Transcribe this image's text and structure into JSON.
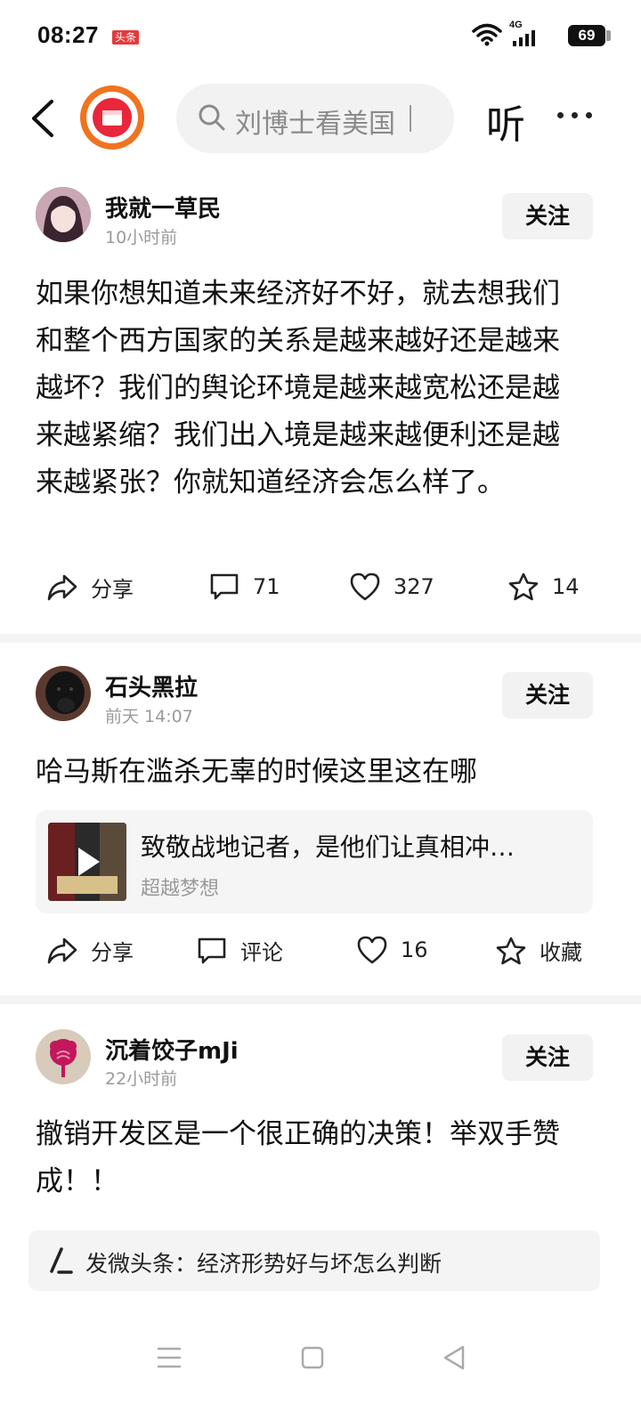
{
  "status_bar": {
    "time": "08:27",
    "app_badge": "头条",
    "network": "4G",
    "battery": "69"
  },
  "top_nav": {
    "search_placeholder": "刘博士看美国",
    "listen_label": "听"
  },
  "posts": [
    {
      "username": "我就一草民",
      "time": "10小时前",
      "follow_label": "关注",
      "content": "如果你想知道未来经济好不好，就去想我们和整个西方国家的关系是越来越好还是越来越坏？我们的舆论环境是越来越宽松还是越来越紧缩？我们出入境是越来越便利还是越来越紧张？你就知道经济会怎么样了。",
      "actions": {
        "share": "分享",
        "comments": "71",
        "likes": "327",
        "favorites": "14"
      }
    },
    {
      "username": "石头黑拉",
      "time": "前天 14:07",
      "follow_label": "关注",
      "content": "哈马斯在滥杀无辜的时候这里这在哪",
      "quote": {
        "title": "致敬战地记者，是他们让真相冲…",
        "author": "超越梦想"
      },
      "actions": {
        "share": "分享",
        "comments": "评论",
        "likes": "16",
        "favorites": "收藏"
      }
    },
    {
      "username": "沉着饺子mJi",
      "time": "22小时前",
      "follow_label": "关注",
      "content": "撤销开发区是一个很正确的决策！举双手赞成！！"
    }
  ],
  "bottom_bar": {
    "text": "发微头条：经济形势好与坏怎么判断"
  },
  "colors": {
    "accent_red": "#e8273b",
    "logo_orange": "#f0731f",
    "muted_text": "#9a9a9a",
    "chip_bg": "#f2f2f3"
  }
}
